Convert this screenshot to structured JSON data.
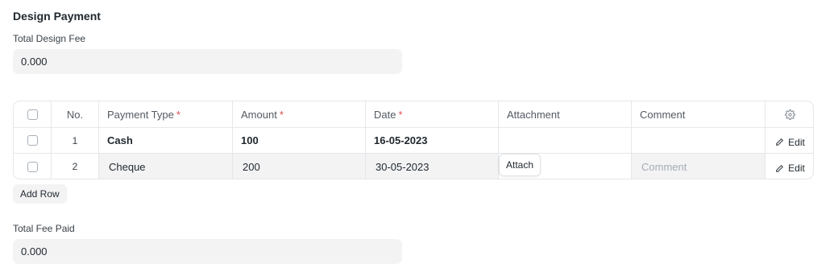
{
  "section": {
    "title": "Design Payment"
  },
  "total_design_fee": {
    "label": "Total Design Fee",
    "value": "0.000"
  },
  "table": {
    "columns": {
      "no": "No.",
      "payment_type": "Payment Type",
      "amount": "Amount",
      "date": "Date",
      "attachment": "Attachment",
      "comment": "Comment"
    },
    "required_marker": "*",
    "rows": [
      {
        "no": "1",
        "payment_type": "Cash",
        "amount": "100",
        "date": "16-05-2023",
        "attachment": "",
        "comment": "",
        "edit_label": "Edit"
      },
      {
        "no": "2",
        "payment_type": "Cheque",
        "amount": "200",
        "date": "30-05-2023",
        "attach_label": "Attach",
        "comment_placeholder": "Comment",
        "edit_label": "Edit"
      }
    ],
    "settings_icon": "gear-icon"
  },
  "add_row": {
    "label": "Add Row"
  },
  "total_fee_paid": {
    "label": "Total Fee Paid",
    "value": "0.000"
  }
}
